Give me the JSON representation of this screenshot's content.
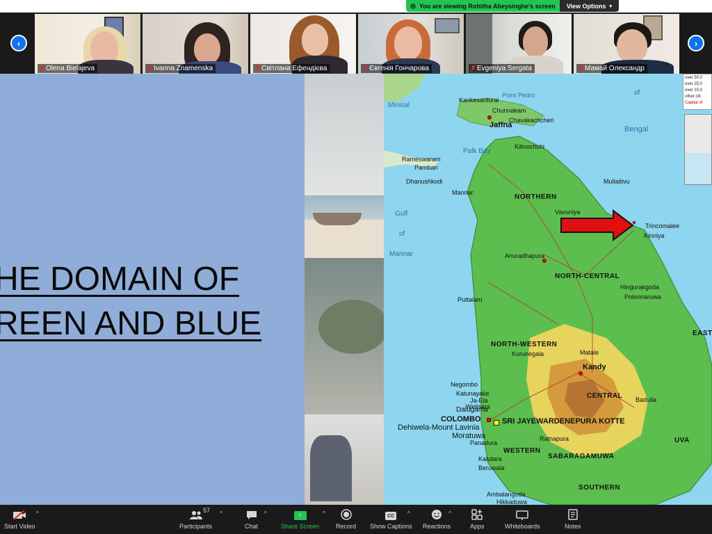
{
  "banner": {
    "viewing_text": "You are viewing Rohitha Abeysinghe's screen",
    "view_options_label": "View Options"
  },
  "participants": [
    {
      "name": "Olena Bielajeva"
    },
    {
      "name": "Ivanna Znamenska"
    },
    {
      "name": "Світлана Ефендієва"
    },
    {
      "name": "Євгенія Гончарова"
    },
    {
      "name": "Evgeniya Sergata"
    },
    {
      "name": "Мамай Олександр"
    }
  ],
  "nav": {
    "prev_icon": "‹",
    "next_icon": "›"
  },
  "slide": {
    "title_line1": "HE DOMAIN OF",
    "title_line2": "REEN AND BLUE"
  },
  "map": {
    "legend_lines": [
      "over 50,0",
      "over 25,0",
      "over 10,0",
      "other citi",
      "Capital of"
    ],
    "labels": {
      "jaffna": "Jaffna",
      "point_pedro": "Point Pedro",
      "kankesanturai": "Kankesanturai",
      "chunnakam": "Chunnakam",
      "chavakachcheri": "Chavakachcheri",
      "palk_bay": "Palk Bay",
      "kilinochchi": "Kilinochchi",
      "rameswaram": "Rameswaram",
      "pamban": "Pamban",
      "dhanushkodi": "Dhanushkodi",
      "gulf": "Gulf",
      "of1": "of",
      "mannar_sea": "Mannar",
      "mannar": "Mannar",
      "northern": "NORTHERN",
      "vavuniya": "Vavuniya",
      "trincomalee": "Trincomalee",
      "kinniya": "Kinniya",
      "bay_of": "of",
      "bengal": "Bengal",
      "anuradhapura": "Anuradhapura",
      "north_central": "NORTH-CENTRAL",
      "puttalam": "Puttalam",
      "north_western": "NORTH-WESTERN",
      "kurunegala": "Kurunegala",
      "matale": "Matale",
      "kandy": "Kandy",
      "eastern": "EASTERN",
      "central": "CENTRAL",
      "badulla": "Badulla",
      "negombo": "Negombo",
      "katunayake": "Katunayake",
      "ja_ela": "Ja-Ela",
      "welisara": "Welisara",
      "dalugama": "Dalugama",
      "colombo": "COLOMBO",
      "dehiwela": "Dehiwela-Mount Lavinia",
      "moratuwa": "Moratuwa",
      "kotte": "SRI JAYEWARDENEPURA KOTTE",
      "western": "WESTERN",
      "sabaragamuwa": "SABARAGAMUWA",
      "ratnapura": "Ratnapura",
      "uva": "UVA",
      "southern": "SOUTHERN",
      "kalutara": "Kalutara",
      "beruwala": "Beruwala",
      "panadura": "Panadura",
      "hingurakgoda": "Hingurakgoda",
      "polonnaruwa": "Polonnaruwa",
      "hikkaduwa": "Hikkaduwa",
      "ambalangoda": "Ambalangoda",
      "minisal": "Minisal",
      "mullaitivu": "Mullaitivu"
    }
  },
  "toolbar": {
    "start_video": "Start Video",
    "participants": "Participants",
    "participants_count": "57",
    "chat": "Chat",
    "share_screen": "Share Screen",
    "record": "Record",
    "show_captions": "Show Captions",
    "cc": "CC",
    "reactions": "Reactions",
    "apps": "Apps",
    "whiteboards": "Whiteboards",
    "notes": "Notes"
  },
  "colors": {
    "accent_green": "#23c552",
    "zoom_blue": "#0e72ed",
    "slide_blue": "#8fadd8",
    "toolbar_bg": "#1a1a1a",
    "arrow_red": "#e01010"
  }
}
